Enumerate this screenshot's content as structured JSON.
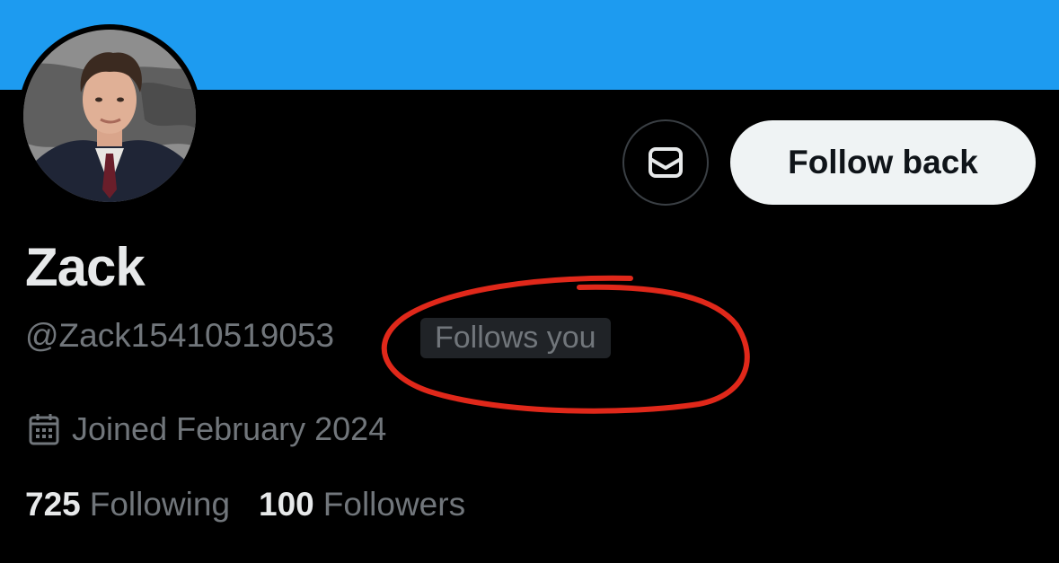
{
  "colors": {
    "banner": "#1d9bf0",
    "background": "#000000",
    "primary_text": "#e7e9ea",
    "secondary_text": "#71767b",
    "follow_button_bg": "#eff3f4",
    "badge_bg": "#202327",
    "annotation": "#e0281a"
  },
  "profile": {
    "display_name": "Zack",
    "handle": "@Zack15410519053",
    "follows_you_badge": "Follows you",
    "joined": "Joined February 2024",
    "avatar_icon": "profile-photo"
  },
  "actions": {
    "message_icon": "envelope-icon",
    "follow_back_label": "Follow back"
  },
  "stats": {
    "following_count": "725",
    "following_label": "Following",
    "followers_count": "100",
    "followers_label": "Followers"
  },
  "meta_icons": {
    "joined_icon": "calendar-icon"
  }
}
